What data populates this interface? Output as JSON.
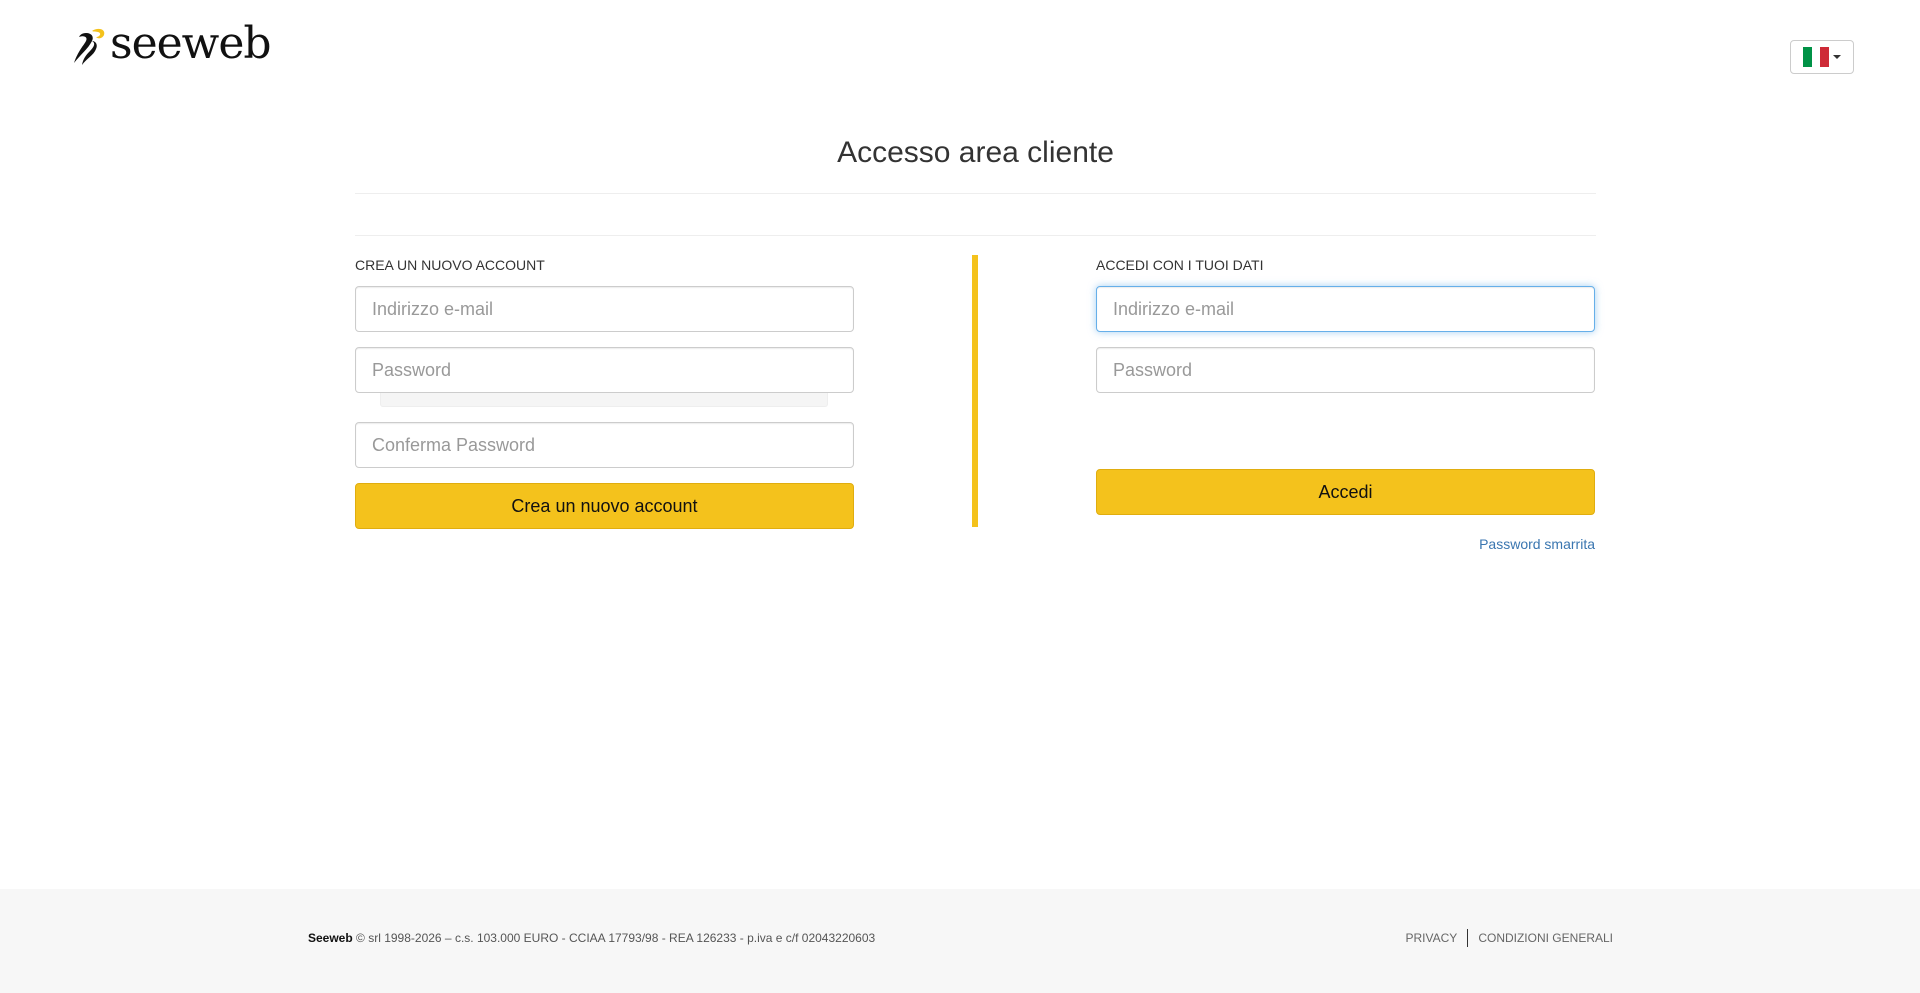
{
  "header": {
    "logo_text": "seeweb",
    "language": {
      "selected": "it",
      "flag_colors": [
        "#009246",
        "#ffffff",
        "#ce2b37"
      ]
    }
  },
  "page": {
    "title": "Accesso area cliente"
  },
  "register": {
    "heading": "CREA UN NUOVO ACCOUNT",
    "email_placeholder": "Indirizzo e-mail",
    "password_placeholder": "Password",
    "confirm_password_placeholder": "Conferma Password",
    "submit_label": "Crea un nuovo account"
  },
  "login": {
    "heading": "ACCEDI CON I TUOI DATI",
    "email_placeholder": "Indirizzo e-mail",
    "password_placeholder": "Password",
    "submit_label": "Accedi",
    "forgot_password_label": "Password smarrita"
  },
  "footer": {
    "company": "Seeweb",
    "legal_text": " © srl 1998-2026 – c.s. 103.000 EURO - CCIAA 17793/98 - REA 126233 - p.iva e c/f 02043220603",
    "links": {
      "privacy": "PRIVACY",
      "terms": "CONDIZIONI GENERALI"
    }
  },
  "colors": {
    "accent": "#f4c21c",
    "link": "#3a76b0",
    "focus": "#66afe9"
  }
}
